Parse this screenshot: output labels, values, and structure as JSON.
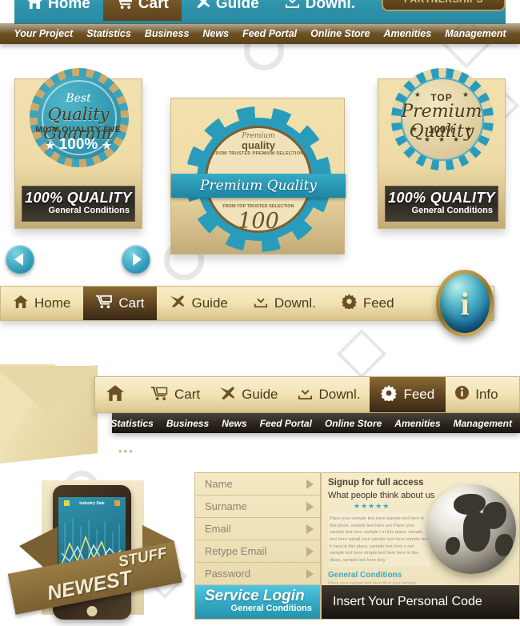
{
  "top_nav": {
    "items": [
      {
        "label": "Home",
        "icon": "home-icon",
        "active": false
      },
      {
        "label": "Cart",
        "icon": "cart-icon",
        "active": true
      },
      {
        "label": "Guide",
        "icon": "plane-icon",
        "active": false
      },
      {
        "label": "Downl.",
        "icon": "download-icon",
        "active": false
      }
    ],
    "cta_label": "PARTNERSHIPS",
    "accent_color": "#2f93ab"
  },
  "sub_nav": {
    "items": [
      "Your Project",
      "Statistics",
      "Business",
      "News",
      "Feed Portal",
      "Online Store",
      "Amenities",
      "Management"
    ],
    "background_color": "#6d5123"
  },
  "badges": {
    "left": {
      "top_script": "Best",
      "main_script": "Quality Guarant",
      "sub_caps": "MIUM QUALITY EVE",
      "percent": "100%",
      "ribbon_big": "100% QUALITY",
      "ribbon_small": "General Conditions",
      "seal_color": "#2f93ab"
    },
    "middle": {
      "line1": "Premium",
      "line2": "quality",
      "line3": "FROM TRUSTED PREMIUM SELECTION",
      "band_label": "Premium Quality",
      "line4": "FROM TOP TRUSTED SELECTION",
      "number": "100",
      "seal_color": "#2a9cbb"
    },
    "right": {
      "top_caps": "TOP",
      "main_script": "Premium Quality",
      "percent": "100%",
      "ribbon_big": "100% QUALITY",
      "ribbon_small": "General Conditions",
      "seal_color": "#2a9cbb"
    }
  },
  "carousel": {
    "prev_label": "Previous",
    "next_label": "Next"
  },
  "gold_nav": {
    "items": [
      {
        "label": "Home",
        "icon": "home-icon",
        "active": false
      },
      {
        "label": "Cart",
        "icon": "cart-icon",
        "active": true
      },
      {
        "label": "Guide",
        "icon": "plane-icon",
        "active": false
      },
      {
        "label": "Downl.",
        "icon": "download-icon",
        "active": false
      },
      {
        "label": "Feed",
        "icon": "gear-icon",
        "active": false
      }
    ],
    "info_glyph": "i",
    "info_label": "Info"
  },
  "envelope_nav": {
    "items": [
      {
        "label": "",
        "icon": "home-icon",
        "active": false
      },
      {
        "label": "Cart",
        "icon": "cart-icon",
        "active": false
      },
      {
        "label": "Guide",
        "icon": "plane-icon",
        "active": false
      },
      {
        "label": "Downl.",
        "icon": "download-icon",
        "active": false
      },
      {
        "label": "Feed",
        "icon": "gear-icon",
        "active": true
      },
      {
        "label": "Info",
        "icon": "info-icon",
        "active": false
      }
    ],
    "sub_items": [
      "Statistics",
      "Business",
      "News",
      "Feed Portal",
      "Online Store",
      "Amenities",
      "Management"
    ],
    "dots": "•••"
  },
  "promo_box": {
    "sash_top": "STUFF",
    "sash_bottom": "NEWEST",
    "phone_chart_title": "Industry Sale",
    "phone_screen_color": "#2f93ab"
  },
  "login_form": {
    "fields": [
      {
        "label": "Name",
        "placeholder": "Name"
      },
      {
        "label": "Surname",
        "placeholder": "Surname"
      },
      {
        "label": "Email",
        "placeholder": "Email"
      },
      {
        "label": "Retype Email",
        "placeholder": "Retype Email"
      },
      {
        "label": "Password",
        "placeholder": "Password"
      }
    ],
    "button_big": "Service Login",
    "button_small": "General Conditions",
    "button_color": "#32a8c2"
  },
  "signup_panel": {
    "heading": "Signup for full access",
    "subheading": "What people think about us",
    "rating": "★★★★★",
    "rating_value": 5,
    "body_text": "Place your sample text here sample text here in this place, sample text here sex Place your sample text here sample t in this place, sample text here sampl your sample text here sample text h here in this place, sample text here s our sample text here simple text here here in this place, sample text here texy",
    "general_conditions_title": "General Conditions",
    "general_conditions_text": "Place your sample text here fill in your sample text here in this place sample text here simple",
    "code_bar_label": "Insert Your Personal Code",
    "accent_color": "#3fa9bc"
  }
}
